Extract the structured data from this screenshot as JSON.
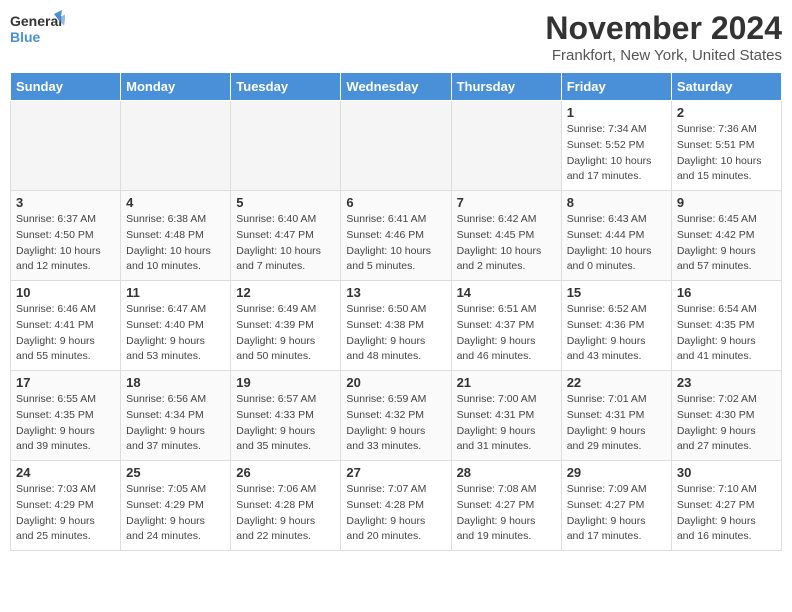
{
  "logo": {
    "text_general": "General",
    "text_blue": "Blue"
  },
  "header": {
    "month": "November 2024",
    "location": "Frankfort, New York, United States"
  },
  "weekdays": [
    "Sunday",
    "Monday",
    "Tuesday",
    "Wednesday",
    "Thursday",
    "Friday",
    "Saturday"
  ],
  "weeks": [
    [
      {
        "day": "",
        "info": ""
      },
      {
        "day": "",
        "info": ""
      },
      {
        "day": "",
        "info": ""
      },
      {
        "day": "",
        "info": ""
      },
      {
        "day": "",
        "info": ""
      },
      {
        "day": "1",
        "info": "Sunrise: 7:34 AM\nSunset: 5:52 PM\nDaylight: 10 hours and 17 minutes."
      },
      {
        "day": "2",
        "info": "Sunrise: 7:36 AM\nSunset: 5:51 PM\nDaylight: 10 hours and 15 minutes."
      }
    ],
    [
      {
        "day": "3",
        "info": "Sunrise: 6:37 AM\nSunset: 4:50 PM\nDaylight: 10 hours and 12 minutes."
      },
      {
        "day": "4",
        "info": "Sunrise: 6:38 AM\nSunset: 4:48 PM\nDaylight: 10 hours and 10 minutes."
      },
      {
        "day": "5",
        "info": "Sunrise: 6:40 AM\nSunset: 4:47 PM\nDaylight: 10 hours and 7 minutes."
      },
      {
        "day": "6",
        "info": "Sunrise: 6:41 AM\nSunset: 4:46 PM\nDaylight: 10 hours and 5 minutes."
      },
      {
        "day": "7",
        "info": "Sunrise: 6:42 AM\nSunset: 4:45 PM\nDaylight: 10 hours and 2 minutes."
      },
      {
        "day": "8",
        "info": "Sunrise: 6:43 AM\nSunset: 4:44 PM\nDaylight: 10 hours and 0 minutes."
      },
      {
        "day": "9",
        "info": "Sunrise: 6:45 AM\nSunset: 4:42 PM\nDaylight: 9 hours and 57 minutes."
      }
    ],
    [
      {
        "day": "10",
        "info": "Sunrise: 6:46 AM\nSunset: 4:41 PM\nDaylight: 9 hours and 55 minutes."
      },
      {
        "day": "11",
        "info": "Sunrise: 6:47 AM\nSunset: 4:40 PM\nDaylight: 9 hours and 53 minutes."
      },
      {
        "day": "12",
        "info": "Sunrise: 6:49 AM\nSunset: 4:39 PM\nDaylight: 9 hours and 50 minutes."
      },
      {
        "day": "13",
        "info": "Sunrise: 6:50 AM\nSunset: 4:38 PM\nDaylight: 9 hours and 48 minutes."
      },
      {
        "day": "14",
        "info": "Sunrise: 6:51 AM\nSunset: 4:37 PM\nDaylight: 9 hours and 46 minutes."
      },
      {
        "day": "15",
        "info": "Sunrise: 6:52 AM\nSunset: 4:36 PM\nDaylight: 9 hours and 43 minutes."
      },
      {
        "day": "16",
        "info": "Sunrise: 6:54 AM\nSunset: 4:35 PM\nDaylight: 9 hours and 41 minutes."
      }
    ],
    [
      {
        "day": "17",
        "info": "Sunrise: 6:55 AM\nSunset: 4:35 PM\nDaylight: 9 hours and 39 minutes."
      },
      {
        "day": "18",
        "info": "Sunrise: 6:56 AM\nSunset: 4:34 PM\nDaylight: 9 hours and 37 minutes."
      },
      {
        "day": "19",
        "info": "Sunrise: 6:57 AM\nSunset: 4:33 PM\nDaylight: 9 hours and 35 minutes."
      },
      {
        "day": "20",
        "info": "Sunrise: 6:59 AM\nSunset: 4:32 PM\nDaylight: 9 hours and 33 minutes."
      },
      {
        "day": "21",
        "info": "Sunrise: 7:00 AM\nSunset: 4:31 PM\nDaylight: 9 hours and 31 minutes."
      },
      {
        "day": "22",
        "info": "Sunrise: 7:01 AM\nSunset: 4:31 PM\nDaylight: 9 hours and 29 minutes."
      },
      {
        "day": "23",
        "info": "Sunrise: 7:02 AM\nSunset: 4:30 PM\nDaylight: 9 hours and 27 minutes."
      }
    ],
    [
      {
        "day": "24",
        "info": "Sunrise: 7:03 AM\nSunset: 4:29 PM\nDaylight: 9 hours and 25 minutes."
      },
      {
        "day": "25",
        "info": "Sunrise: 7:05 AM\nSunset: 4:29 PM\nDaylight: 9 hours and 24 minutes."
      },
      {
        "day": "26",
        "info": "Sunrise: 7:06 AM\nSunset: 4:28 PM\nDaylight: 9 hours and 22 minutes."
      },
      {
        "day": "27",
        "info": "Sunrise: 7:07 AM\nSunset: 4:28 PM\nDaylight: 9 hours and 20 minutes."
      },
      {
        "day": "28",
        "info": "Sunrise: 7:08 AM\nSunset: 4:27 PM\nDaylight: 9 hours and 19 minutes."
      },
      {
        "day": "29",
        "info": "Sunrise: 7:09 AM\nSunset: 4:27 PM\nDaylight: 9 hours and 17 minutes."
      },
      {
        "day": "30",
        "info": "Sunrise: 7:10 AM\nSunset: 4:27 PM\nDaylight: 9 hours and 16 minutes."
      }
    ]
  ]
}
